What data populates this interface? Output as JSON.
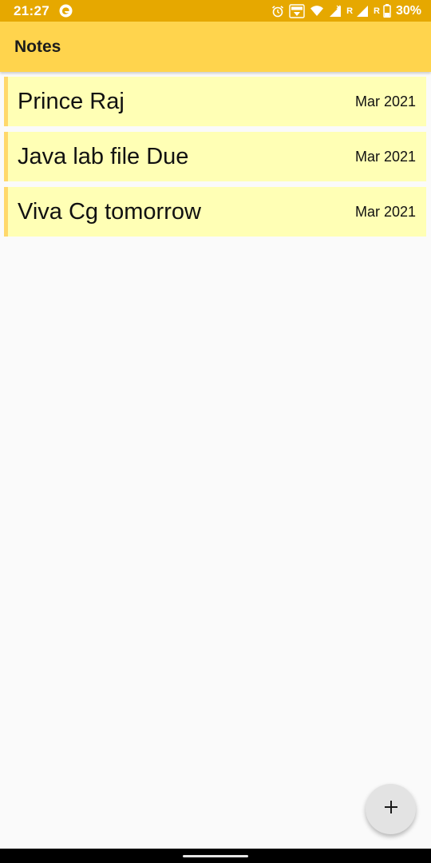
{
  "status_bar": {
    "time": "21:27",
    "roaming_1": "R",
    "roaming_2": "R",
    "battery": "30%",
    "icons": [
      "edge-browser-icon",
      "alarm-icon",
      "volte-icon",
      "wifi-icon",
      "signal-icon",
      "signal-icon",
      "battery-icon"
    ]
  },
  "app_bar": {
    "title": "Notes"
  },
  "notes": [
    {
      "title": "Prince Raj",
      "date": "Mar 2021"
    },
    {
      "title": "Java lab file Due",
      "date": "Mar 2021"
    },
    {
      "title": "Viva Cg tomorrow",
      "date": "Mar 2021"
    }
  ],
  "fab": {
    "icon": "plus-icon"
  },
  "colors": {
    "status_bar": "#e6a800",
    "app_bar": "#ffd44d",
    "note_background": "#ffffb5",
    "note_accent": "#ffd86b",
    "fab": "#e3e3e3"
  }
}
